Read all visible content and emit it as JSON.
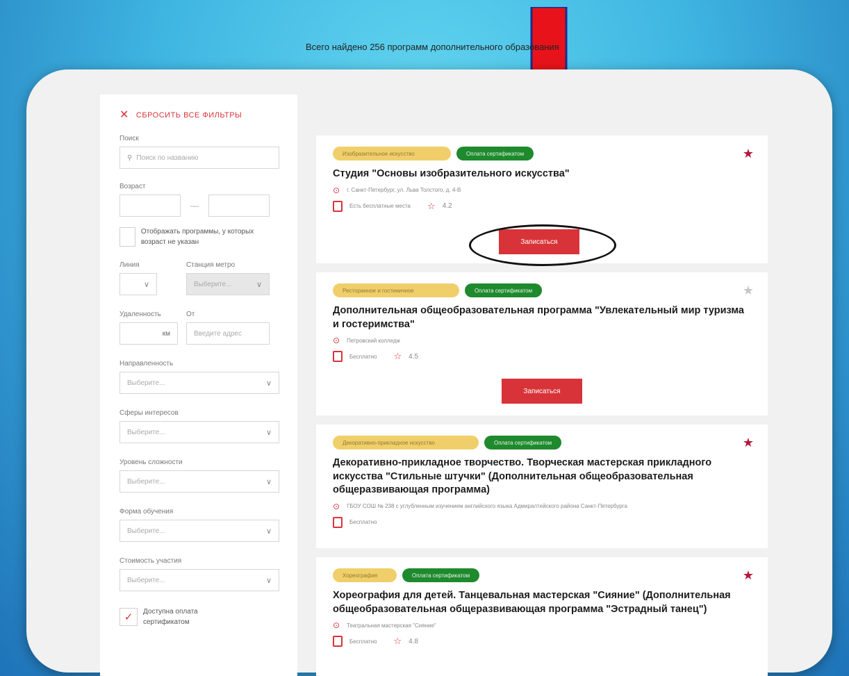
{
  "sidebar": {
    "reset_label": "СБРОСИТЬ ВСЕ ФИЛЬТРЫ",
    "search_label": "Поиск",
    "search_placeholder": "Поиск по названию",
    "age_label": "Возраст",
    "age_dash": "—",
    "show_no_age": "Отображать программы, у которых возраст не указан",
    "line_label": "Линия",
    "metro_label": "Станция метро",
    "metro_placeholder": "Выберите...",
    "distance_label": "Удаленность",
    "from_label": "От",
    "km_unit": "км",
    "address_placeholder": "Введите адрес",
    "direction_label": "Направленность",
    "interests_label": "Сферы интересов",
    "difficulty_label": "Уровень сложности",
    "form_label": "Форма обучения",
    "cost_label": "Стоимость участия",
    "select_placeholder": "Выберите...",
    "certificate_label": "Доступна оплата сертификатом"
  },
  "main": {
    "total_text": "Всего найдено 256 программ дополнительного образования",
    "enroll_label": "Записаться",
    "cards": [
      {
        "tag1": "Изобразительное искусство",
        "tag2": "Оплата сертификатом",
        "title": "Студия \"Основы изобразительного искусства\"",
        "address": "г. Санкт-Петербург, ул. Льва Толстого, д. 4-В",
        "price": "Есть бесплатные места",
        "rating": "4.2"
      },
      {
        "tag1": "Ресторанное и гостиничное",
        "tag2": "Оплата сертификатом",
        "title": "Дополнительная общеобразовательная программа \"Увлекательный мир туризма и гостеримства\"",
        "address": "Петровский колледж",
        "price": "Бесплатно",
        "rating": "4.5"
      },
      {
        "tag1": "Декоративно-прикладное искусство",
        "tag2": "Оплата сертификатом",
        "title": "Декоративно-прикладное творчество. Творческая мастерская прикладного искусства \"Стильные штучки\" (Дополнительная общеобразовательная общеразвивающая программа)",
        "address": "ГБОУ СОШ № 238 с углубленным изучением английского языка Адмиралтейского района Санкт-Петербурга",
        "price": "Бесплатно"
      },
      {
        "tag1": "Хореография",
        "tag2": "Оплата сертификатом",
        "title": "Хореография для детей. Танцевальная мастерская \"Сияние\" (Дополнительная общеобразовательная общеразвивающая программа \"Эстрадный танец\")",
        "address": "Театральная мастерская \"Сияние\"",
        "price": "Бесплатно",
        "rating": "4.8"
      }
    ]
  },
  "colors": {
    "accent": "#d9333a",
    "arrow": "#e8131a",
    "tag_yellow": "#f0cf6a",
    "tag_green": "#1e8a2d",
    "fav_star": "#b3193a"
  },
  "icons": [
    "close-icon",
    "search-icon",
    "chevron-down-icon",
    "check-icon",
    "location-pin-icon",
    "document-icon",
    "star-outline-icon",
    "favorite-star-icon",
    "down-arrow-annotation"
  ]
}
